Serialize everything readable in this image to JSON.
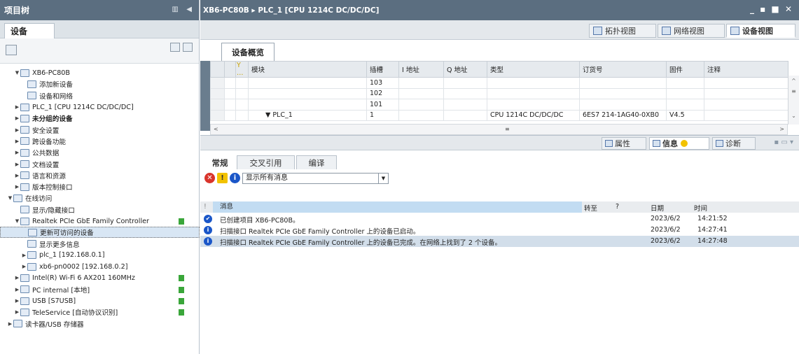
{
  "left": {
    "title": "项目树",
    "tab": "设备",
    "tree": [
      {
        "label": "XB6-PC80B",
        "arrow": "▼",
        "indent": 0
      },
      {
        "label": "添加新设备",
        "arrow": "",
        "indent": 1
      },
      {
        "label": "设备和网络",
        "arrow": "",
        "indent": 1
      },
      {
        "label": "PLC_1 [CPU 1214C DC/DC/DC]",
        "arrow": "▶",
        "indent": 0
      },
      {
        "label": "未分组的设备",
        "arrow": "▶",
        "indent": 0,
        "bold": true
      },
      {
        "label": "安全设置",
        "arrow": "▶",
        "indent": 0
      },
      {
        "label": "跨设备功能",
        "arrow": "▶",
        "indent": 0
      },
      {
        "label": "公共数据",
        "arrow": "▶",
        "indent": 0
      },
      {
        "label": "文档设置",
        "arrow": "▶",
        "indent": 0
      },
      {
        "label": "语言和资源",
        "arrow": "▶",
        "indent": 0
      },
      {
        "label": "版本控制接口",
        "arrow": "▶",
        "indent": 0
      },
      {
        "label": "在线访问",
        "arrow": "▼",
        "indent": -1
      },
      {
        "label": "显示/隐藏接口",
        "arrow": "",
        "indent": 0
      },
      {
        "label": "Realtek PCIe GbE Family Controller",
        "arrow": "▼",
        "indent": 0,
        "flag": true
      },
      {
        "label": "更新可访问的设备",
        "arrow": "",
        "indent": 1,
        "selected": true
      },
      {
        "label": "显示更多信息",
        "arrow": "",
        "indent": 1
      },
      {
        "label": "plc_1 [192.168.0.1]",
        "arrow": "▶",
        "indent": 1
      },
      {
        "label": "xb6-pn0002 [192.168.0.2]",
        "arrow": "▶",
        "indent": 1
      },
      {
        "label": "Intel(R) Wi-Fi 6 AX201 160MHz",
        "arrow": "▶",
        "indent": 0,
        "flag": true
      },
      {
        "label": "PC internal [本地]",
        "arrow": "▶",
        "indent": 0,
        "flag": true
      },
      {
        "label": "USB [S7USB]",
        "arrow": "▶",
        "indent": 0,
        "flag": true
      },
      {
        "label": "TeleService [自动协议识别]",
        "arrow": "▶",
        "indent": 0,
        "flag": true
      },
      {
        "label": "读卡器/USB 存储器",
        "arrow": "▶",
        "indent": -1
      }
    ]
  },
  "window": {
    "title": "XB6-PC80B ▸ PLC_1 [CPU 1214C DC/DC/DC]",
    "controls": "_ ▪ ■ ✕"
  },
  "views": {
    "topology": "拓扑视图",
    "network": "网络视图",
    "device": "设备视图"
  },
  "overview": {
    "tab": "设备概览",
    "columns": [
      "…",
      "模块",
      "插槽",
      "I 地址",
      "Q 地址",
      "类型",
      "订货号",
      "固件",
      "注释"
    ],
    "rows": [
      {
        "module": "",
        "slot": "103",
        "i": "",
        "q": "",
        "type": "",
        "order": "",
        "fw": "",
        "comment": ""
      },
      {
        "module": "",
        "slot": "102",
        "i": "",
        "q": "",
        "type": "",
        "order": "",
        "fw": "",
        "comment": ""
      },
      {
        "module": "",
        "slot": "101",
        "i": "",
        "q": "",
        "type": "",
        "order": "",
        "fw": "",
        "comment": ""
      },
      {
        "module": "▼ PLC_1",
        "slot": "1",
        "i": "",
        "q": "",
        "type": "CPU 1214C DC/DC/DC",
        "order": "6ES7 214-1AG40-0XB0",
        "fw": "V4.5",
        "comment": ""
      }
    ]
  },
  "inspector": {
    "properties": "属性",
    "info": "信息",
    "diagnostics": "诊断",
    "tabs": [
      "常规",
      "交叉引用",
      "编译"
    ],
    "filter_value": "显示所有消息",
    "msg_columns": {
      "message": "消息",
      "goto": "转至",
      "q": "?",
      "date": "日期",
      "time": "时间"
    },
    "messages": [
      {
        "icon": "check",
        "text": "已创建项目 XB6-PC80B。",
        "date": "2023/6/2",
        "time": "14:21:52"
      },
      {
        "icon": "info",
        "text": "扫描接口 Realtek PCIe GbE Family Controller 上的设备已启动。",
        "date": "2023/6/2",
        "time": "14:27:41"
      },
      {
        "icon": "info",
        "text": "扫描接口 Realtek PCIe GbE Family Controller 上的设备已完成。在网络上找到了 2 个设备。",
        "date": "2023/6/2",
        "time": "14:27:48"
      }
    ]
  },
  "colors": {
    "title_bar": "#5b6e80",
    "selection": "#d2deea",
    "online_flag": "#3aa63a",
    "info_blue": "#1a56c8",
    "error_red": "#d9342b",
    "warning_yellow": "#f2c200"
  }
}
